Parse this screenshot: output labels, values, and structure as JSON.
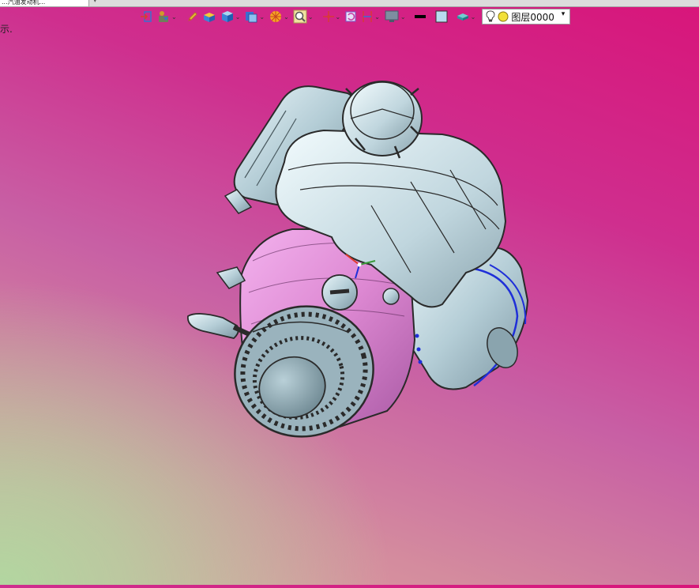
{
  "tab": {
    "label": "...汽油发动机...",
    "arrow": "▾"
  },
  "status": {
    "text": "示."
  },
  "layer": {
    "name": "图层0000",
    "arrow": "▾"
  },
  "toolbar": {
    "icons": [
      "exit-sketch-icon",
      "assembly-icon",
      "pencil-icon",
      "box-icon",
      "cube-icon",
      "view-icon",
      "sun-icon",
      "zoom-icon",
      "crosshair-icon",
      "rotate-icon",
      "section-icon",
      "monitor-icon",
      "line-color-icon",
      "fill-color-icon",
      "material-icon",
      "bulb-icon",
      "light-icon"
    ]
  },
  "colors": {
    "accent": "#1f2fd8",
    "model": "#a9c3cc",
    "model_pink": "#e59ad8"
  }
}
